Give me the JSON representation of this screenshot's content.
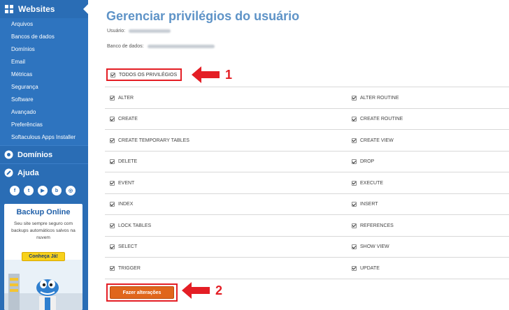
{
  "sidebar": {
    "section_title": "Websites",
    "items": [
      "Arquivos",
      "Bancos de dados",
      "Domínios",
      "Email",
      "Métricas",
      "Segurança",
      "Software",
      "Avançado",
      "Preferências",
      "Softaculous Apps Installer"
    ],
    "domains_label": "Domínios",
    "help_label": "Ajuda",
    "social": [
      "f",
      "t",
      "▶",
      "b",
      "◎"
    ],
    "promo": {
      "title": "Backup Online",
      "text": "Seu site sempre seguro com backups automáticos salvos na nuvem",
      "button": "Conheça Já!"
    }
  },
  "main": {
    "title": "Gerenciar privilégios do usuário",
    "user_label": "Usuário:",
    "db_label": "Banco de dados:",
    "all_privileges": "TODOS OS PRIVILÉGIOS",
    "privileges_left": [
      "ALTER",
      "CREATE",
      "CREATE TEMPORARY TABLES",
      "DELETE",
      "EVENT",
      "INDEX",
      "LOCK TABLES",
      "SELECT",
      "TRIGGER"
    ],
    "privileges_right": [
      "ALTER ROUTINE",
      "CREATE ROUTINE",
      "CREATE VIEW",
      "DROP",
      "EXECUTE",
      "INSERT",
      "REFERENCES",
      "SHOW VIEW",
      "UPDATE"
    ],
    "submit_label": "Fazer alterações"
  },
  "annotations": {
    "step1": "1",
    "step2": "2"
  },
  "colors": {
    "sidebar": "#2a6db5",
    "title": "#5e93c7",
    "highlight": "#e41e25",
    "button": "#e0661c"
  }
}
